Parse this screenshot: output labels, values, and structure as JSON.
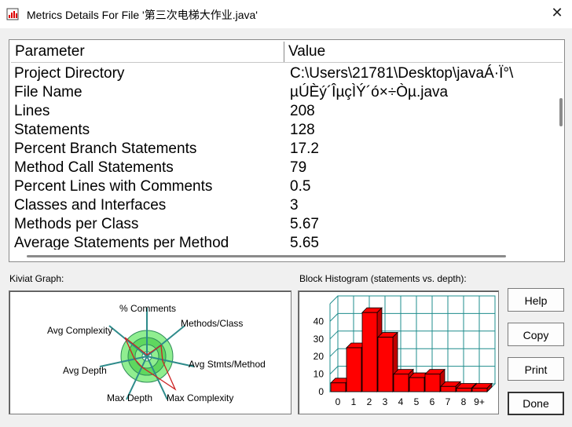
{
  "window": {
    "title": "Metrics Details For File '第三次电梯大作业.java'",
    "close_glyph": "✕"
  },
  "table": {
    "headers": [
      "Parameter",
      "Value"
    ],
    "rows": [
      [
        "Project Directory",
        "C:\\Users\\21781\\Desktop\\javaÁ·Ï°\\"
      ],
      [
        "File Name",
        "µÚÈý´ÎµçÌÝ´ó×÷Òµ.java"
      ],
      [
        "Lines",
        "208"
      ],
      [
        "Statements",
        "128"
      ],
      [
        "Percent Branch Statements",
        "17.2"
      ],
      [
        "Method Call Statements",
        "79"
      ],
      [
        "Percent Lines with Comments",
        "0.5"
      ],
      [
        "Classes and Interfaces",
        "3"
      ],
      [
        "Methods per Class",
        "5.67"
      ],
      [
        "Average Statements per Method",
        "5.65"
      ]
    ]
  },
  "kiviat": {
    "group_label": "Kiviat Graph:",
    "axes": [
      "% Comments",
      "Methods/Class",
      "Avg Stmts/Method",
      "Max Complexity",
      "Max Depth",
      "Avg Depth",
      "Avg Complexity"
    ]
  },
  "histogram": {
    "group_label": "Block Histogram (statements vs. depth):",
    "bar_color": "#ff0000"
  },
  "buttons": {
    "help": "Help",
    "copy": "Copy",
    "print": "Print",
    "done": "Done"
  },
  "chart_data": {
    "type": "bar",
    "categories": [
      "0",
      "1",
      "2",
      "3",
      "4",
      "5",
      "6",
      "7",
      "8",
      "9+"
    ],
    "values": [
      5,
      25,
      45,
      31,
      10,
      8,
      10,
      3,
      2,
      2
    ],
    "ylim": [
      0,
      50
    ],
    "yticks": [
      0,
      10,
      20,
      30,
      40
    ],
    "grid": true
  }
}
